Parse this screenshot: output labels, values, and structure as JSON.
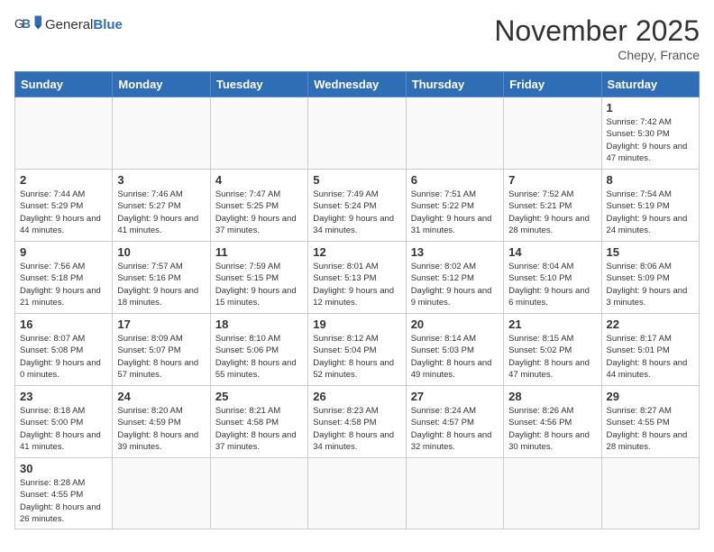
{
  "header": {
    "logo_general": "General",
    "logo_blue": "Blue",
    "month_title": "November 2025",
    "location": "Chepy, France"
  },
  "days_of_week": [
    "Sunday",
    "Monday",
    "Tuesday",
    "Wednesday",
    "Thursday",
    "Friday",
    "Saturday"
  ],
  "weeks": [
    [
      {
        "day": "",
        "info": ""
      },
      {
        "day": "",
        "info": ""
      },
      {
        "day": "",
        "info": ""
      },
      {
        "day": "",
        "info": ""
      },
      {
        "day": "",
        "info": ""
      },
      {
        "day": "",
        "info": ""
      },
      {
        "day": "1",
        "info": "Sunrise: 7:42 AM\nSunset: 5:30 PM\nDaylight: 9 hours and 47 minutes."
      }
    ],
    [
      {
        "day": "2",
        "info": "Sunrise: 7:44 AM\nSunset: 5:29 PM\nDaylight: 9 hours and 44 minutes."
      },
      {
        "day": "3",
        "info": "Sunrise: 7:46 AM\nSunset: 5:27 PM\nDaylight: 9 hours and 41 minutes."
      },
      {
        "day": "4",
        "info": "Sunrise: 7:47 AM\nSunset: 5:25 PM\nDaylight: 9 hours and 37 minutes."
      },
      {
        "day": "5",
        "info": "Sunrise: 7:49 AM\nSunset: 5:24 PM\nDaylight: 9 hours and 34 minutes."
      },
      {
        "day": "6",
        "info": "Sunrise: 7:51 AM\nSunset: 5:22 PM\nDaylight: 9 hours and 31 minutes."
      },
      {
        "day": "7",
        "info": "Sunrise: 7:52 AM\nSunset: 5:21 PM\nDaylight: 9 hours and 28 minutes."
      },
      {
        "day": "8",
        "info": "Sunrise: 7:54 AM\nSunset: 5:19 PM\nDaylight: 9 hours and 24 minutes."
      }
    ],
    [
      {
        "day": "9",
        "info": "Sunrise: 7:56 AM\nSunset: 5:18 PM\nDaylight: 9 hours and 21 minutes."
      },
      {
        "day": "10",
        "info": "Sunrise: 7:57 AM\nSunset: 5:16 PM\nDaylight: 9 hours and 18 minutes."
      },
      {
        "day": "11",
        "info": "Sunrise: 7:59 AM\nSunset: 5:15 PM\nDaylight: 9 hours and 15 minutes."
      },
      {
        "day": "12",
        "info": "Sunrise: 8:01 AM\nSunset: 5:13 PM\nDaylight: 9 hours and 12 minutes."
      },
      {
        "day": "13",
        "info": "Sunrise: 8:02 AM\nSunset: 5:12 PM\nDaylight: 9 hours and 9 minutes."
      },
      {
        "day": "14",
        "info": "Sunrise: 8:04 AM\nSunset: 5:10 PM\nDaylight: 9 hours and 6 minutes."
      },
      {
        "day": "15",
        "info": "Sunrise: 8:06 AM\nSunset: 5:09 PM\nDaylight: 9 hours and 3 minutes."
      }
    ],
    [
      {
        "day": "16",
        "info": "Sunrise: 8:07 AM\nSunset: 5:08 PM\nDaylight: 9 hours and 0 minutes."
      },
      {
        "day": "17",
        "info": "Sunrise: 8:09 AM\nSunset: 5:07 PM\nDaylight: 8 hours and 57 minutes."
      },
      {
        "day": "18",
        "info": "Sunrise: 8:10 AM\nSunset: 5:06 PM\nDaylight: 8 hours and 55 minutes."
      },
      {
        "day": "19",
        "info": "Sunrise: 8:12 AM\nSunset: 5:04 PM\nDaylight: 8 hours and 52 minutes."
      },
      {
        "day": "20",
        "info": "Sunrise: 8:14 AM\nSunset: 5:03 PM\nDaylight: 8 hours and 49 minutes."
      },
      {
        "day": "21",
        "info": "Sunrise: 8:15 AM\nSunset: 5:02 PM\nDaylight: 8 hours and 47 minutes."
      },
      {
        "day": "22",
        "info": "Sunrise: 8:17 AM\nSunset: 5:01 PM\nDaylight: 8 hours and 44 minutes."
      }
    ],
    [
      {
        "day": "23",
        "info": "Sunrise: 8:18 AM\nSunset: 5:00 PM\nDaylight: 8 hours and 41 minutes."
      },
      {
        "day": "24",
        "info": "Sunrise: 8:20 AM\nSunset: 4:59 PM\nDaylight: 8 hours and 39 minutes."
      },
      {
        "day": "25",
        "info": "Sunrise: 8:21 AM\nSunset: 4:58 PM\nDaylight: 8 hours and 37 minutes."
      },
      {
        "day": "26",
        "info": "Sunrise: 8:23 AM\nSunset: 4:58 PM\nDaylight: 8 hours and 34 minutes."
      },
      {
        "day": "27",
        "info": "Sunrise: 8:24 AM\nSunset: 4:57 PM\nDaylight: 8 hours and 32 minutes."
      },
      {
        "day": "28",
        "info": "Sunrise: 8:26 AM\nSunset: 4:56 PM\nDaylight: 8 hours and 30 minutes."
      },
      {
        "day": "29",
        "info": "Sunrise: 8:27 AM\nSunset: 4:55 PM\nDaylight: 8 hours and 28 minutes."
      }
    ],
    [
      {
        "day": "30",
        "info": "Sunrise: 8:28 AM\nSunset: 4:55 PM\nDaylight: 8 hours and 26 minutes."
      },
      {
        "day": "",
        "info": ""
      },
      {
        "day": "",
        "info": ""
      },
      {
        "day": "",
        "info": ""
      },
      {
        "day": "",
        "info": ""
      },
      {
        "day": "",
        "info": ""
      },
      {
        "day": "",
        "info": ""
      }
    ]
  ]
}
